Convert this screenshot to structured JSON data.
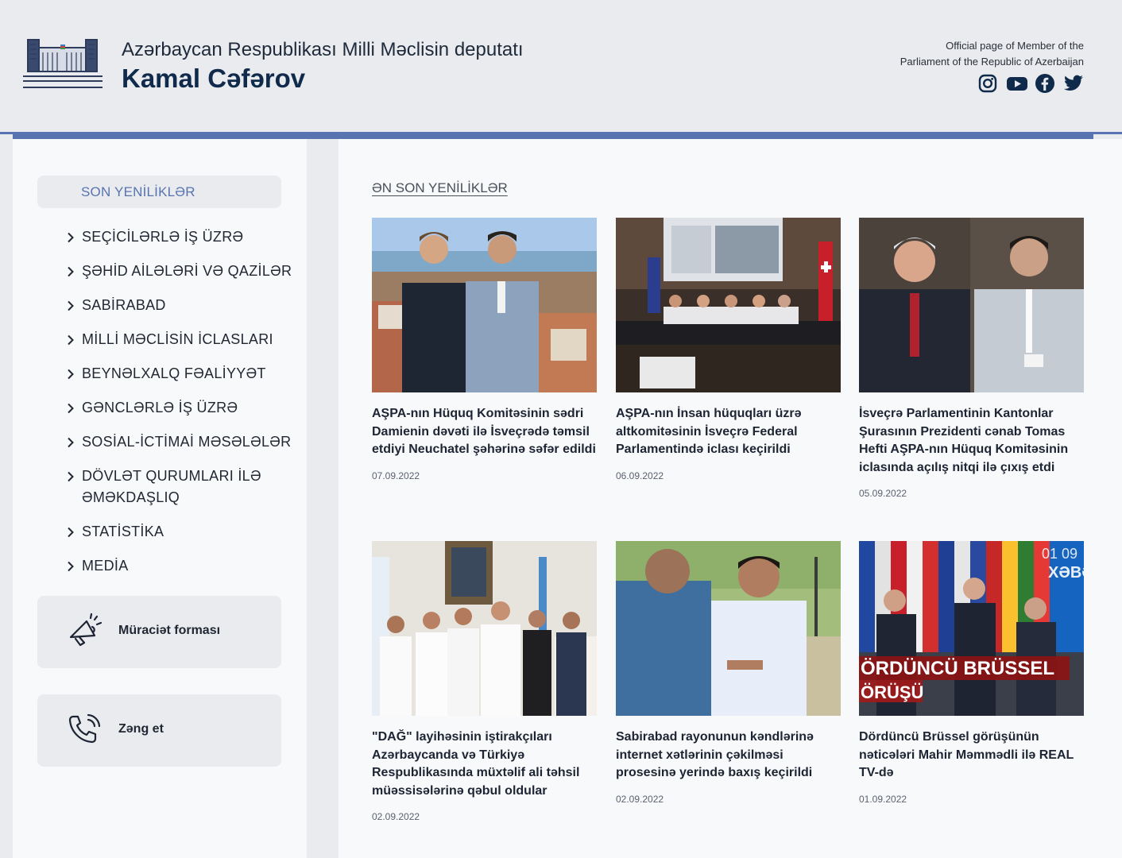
{
  "header": {
    "subtitle": "Azərbaycan Respublikası Milli Məclisin deputatı",
    "name": "Kamal Cəfərov",
    "official_line1": "Official page of Member of the",
    "official_line2": "Parliament of the Republic of Azerbaijan",
    "socials": [
      "instagram-icon",
      "youtube-icon",
      "facebook-icon",
      "twitter-icon"
    ]
  },
  "sidebar": {
    "active": "SON YENİLİKLƏR",
    "items": [
      {
        "label": "SEÇİCİLƏRLƏ İŞ ÜZRƏ"
      },
      {
        "label": "ŞƏHİD AİLƏLƏRİ VƏ QAZİLƏR"
      },
      {
        "label": "SABİRABAD"
      },
      {
        "label": "MİLLİ MƏCLİSİN İCLASLARI"
      },
      {
        "label": "BEYNƏLXALQ FƏALİYYƏT"
      },
      {
        "label": "GƏNCLƏRLƏ İŞ ÜZRƏ"
      },
      {
        "label": "SOSİAL-İCTİMAİ MƏSƏLƏLƏR"
      },
      {
        "label": "DÖVLƏT QURUMLARI İLƏ ƏMƏKDAŞLIQ"
      },
      {
        "label": "STATİSTİKA"
      },
      {
        "label": "MEDİA"
      }
    ],
    "form_card": "Müraciət forması",
    "call_card": "Zəng et"
  },
  "main": {
    "section_title": "ƏN SON YENİLİKLƏR",
    "news": [
      {
        "title": "AŞPA-nın Hüquq Komitəsinin sədri Damienin dəvəti ilə İsveçrədə təmsil etdiyi Neuchatel şəhərinə səfər edildi",
        "date": "07.09.2022"
      },
      {
        "title": "AŞPA-nın İnsan hüquqları üzrə altkomitəsinin İsveçrə Federal Parlamentində iclası keçirildi",
        "date": "06.09.2022"
      },
      {
        "title": "İsveçrə Parlamentinin Kantonlar Şurasının Prezidenti cənab Tomas Hefti AŞPA-nın Hüquq Komitəsinin iclasında açılış nitqi ilə çıxış etdi",
        "date": "05.09.2022"
      },
      {
        "title": "\"DAĞ\" layihəsinin iştirakçıları Azərbaycanda və Türkiyə Respublikasında müxtəlif ali təhsil müəssisələrinə qəbul oldular",
        "date": "02.09.2022"
      },
      {
        "title": "Sabirabad rayonunun kəndlərinə internet xətlərinin çəkilməsi prosesinə yerində baxış keçirildi",
        "date": "02.09.2022"
      },
      {
        "title": "Dördüncü Brüssel görüşünün nəticələri Mahir Məmmədli ilə REAL TV-də",
        "date": "01.09.2022"
      }
    ],
    "overlay_texts": {
      "tv_time": "01 09",
      "tv_channel": "XƏBƏ",
      "tv_banner_line1": "ÖRDÜNCÜ BRÜSSEL",
      "tv_banner_line2": "ÖRÜŞÜ"
    }
  }
}
